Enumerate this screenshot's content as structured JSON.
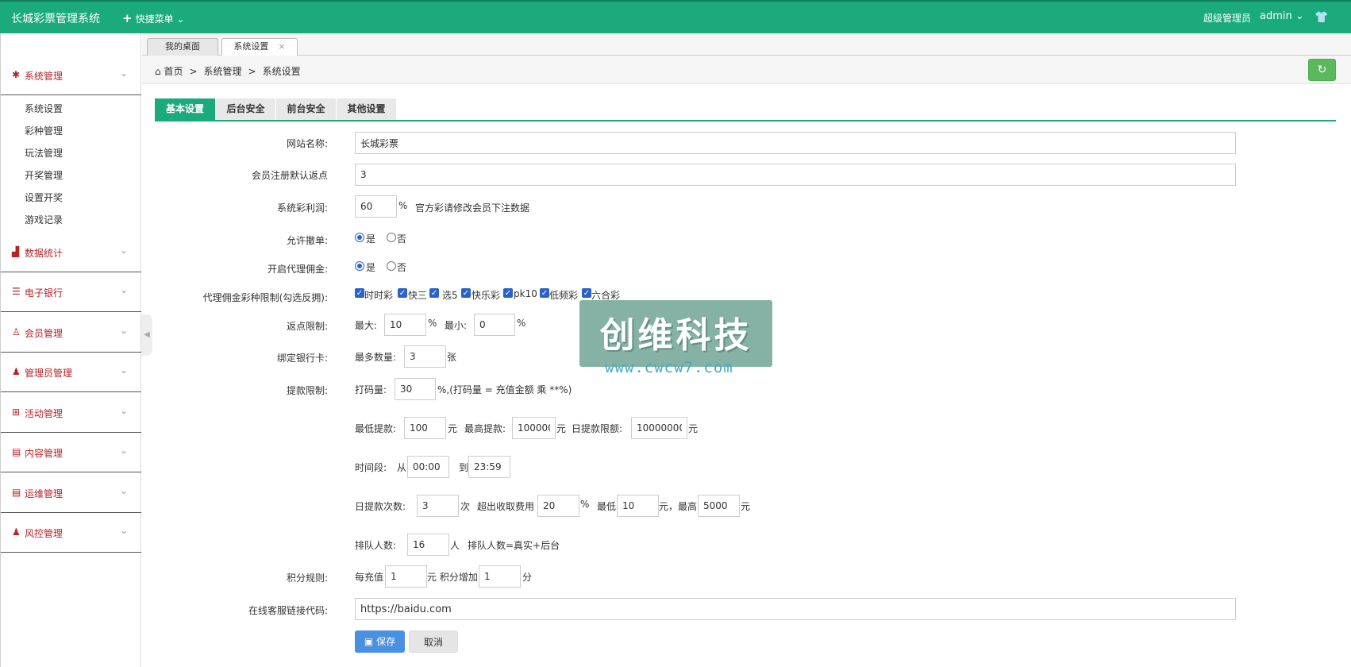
{
  "topbar": {
    "brand": "长城彩票管理系统",
    "quick_menu": "快捷菜单",
    "role": "超级管理员",
    "user": "admin"
  },
  "sidebar": {
    "groups": [
      {
        "label": "系统管理",
        "icon": "gear-icon"
      },
      {
        "label": "数据统计",
        "icon": "bar-chart-icon"
      },
      {
        "label": "电子银行",
        "icon": "list-icon"
      },
      {
        "label": "会员管理",
        "icon": "user-outline-icon"
      },
      {
        "label": "管理员管理",
        "icon": "user-icon"
      },
      {
        "label": "活动管理",
        "icon": "gift-icon"
      },
      {
        "label": "内容管理",
        "icon": "book-icon"
      },
      {
        "label": "运维管理",
        "icon": "book-icon"
      },
      {
        "label": "风控管理",
        "icon": "user-icon"
      }
    ],
    "sub_items": [
      "系统设置",
      "彩种管理",
      "玩法管理",
      "开奖管理",
      "设置开奖",
      "游戏记录"
    ]
  },
  "tabs": [
    {
      "label": "我的桌面"
    },
    {
      "label": "系统设置",
      "close": "×"
    }
  ],
  "breadcrumb": {
    "home": "首页",
    "sep": ">",
    "level1": "系统管理",
    "level2": "系统设置"
  },
  "settings_tabs": [
    "基本设置",
    "后台安全",
    "前台安全",
    "其他设置"
  ],
  "form": {
    "site_name": {
      "label": "网站名称:",
      "value": "长城彩票"
    },
    "rebate": {
      "label": "会员注册默认返点",
      "value": "3"
    },
    "profit": {
      "label": "系统彩利润:",
      "value": "60",
      "unit": "%",
      "note": "官方彩请修改会员下注数据"
    },
    "allow_cancel": {
      "label": "允许撤单:",
      "yes": "是",
      "no": "否"
    },
    "agent_comm": {
      "label": "开启代理佣金:",
      "yes": "是",
      "no": "否"
    },
    "agent_limit": {
      "label": "代理佣金彩种限制(勾选反拥):",
      "options": [
        "时时彩",
        "快三",
        "选5",
        "快乐彩",
        "pk10",
        "低频彩",
        "六合彩"
      ]
    },
    "rebate_limit": {
      "label": "返点限制:",
      "max_label": "最大:",
      "max": "10",
      "pct": "%",
      "min_label": "最小:",
      "min": "0"
    },
    "bind_card": {
      "label": "绑定银行卡:",
      "prefix": "最多数量:",
      "value": "3",
      "unit": "张"
    },
    "withdraw": {
      "label": "提款限制:",
      "code_label": "打码量:",
      "code": "30",
      "code_note": "%,(打码量 = 充值金额 乘 **%)",
      "min_label": "最低提款:",
      "min": "100",
      "yuan": "元",
      "max_label": "最高提款:",
      "max": "100000",
      "day_label": "日提款限额:",
      "day": "10000000",
      "time_label": "时间段:",
      "from": "从",
      "from_val": "00:00",
      "to": "到",
      "to_val": "23:59",
      "count_label": "日提款次数:",
      "count": "3",
      "count_unit": "次",
      "fee_label": "超出收取费用",
      "fee": "20",
      "fee_pct": "%",
      "fee_min_label": "最低",
      "fee_min": "10",
      "fee_max_label": "元，最高",
      "fee_max": "5000",
      "queue_label": "排队人数:",
      "queue": "16",
      "queue_unit": "人",
      "queue_note": "排队人数=真实+后台"
    },
    "points": {
      "label": "积分规则:",
      "prefix": "每充值",
      "value": "1",
      "mid": "元 积分增加",
      "value2": "1",
      "unit": "分"
    },
    "service": {
      "label": "在线客服链接代码:",
      "value": "https://baidu.com"
    }
  },
  "buttons": {
    "save": "保存",
    "cancel": "取消"
  },
  "watermark": {
    "title": "创维科技",
    "url": "www.cwcw7.com"
  },
  "colors": {
    "primary": "#1aaa7c",
    "menu_red": "#b3232a",
    "save_blue": "#4a90e2"
  }
}
